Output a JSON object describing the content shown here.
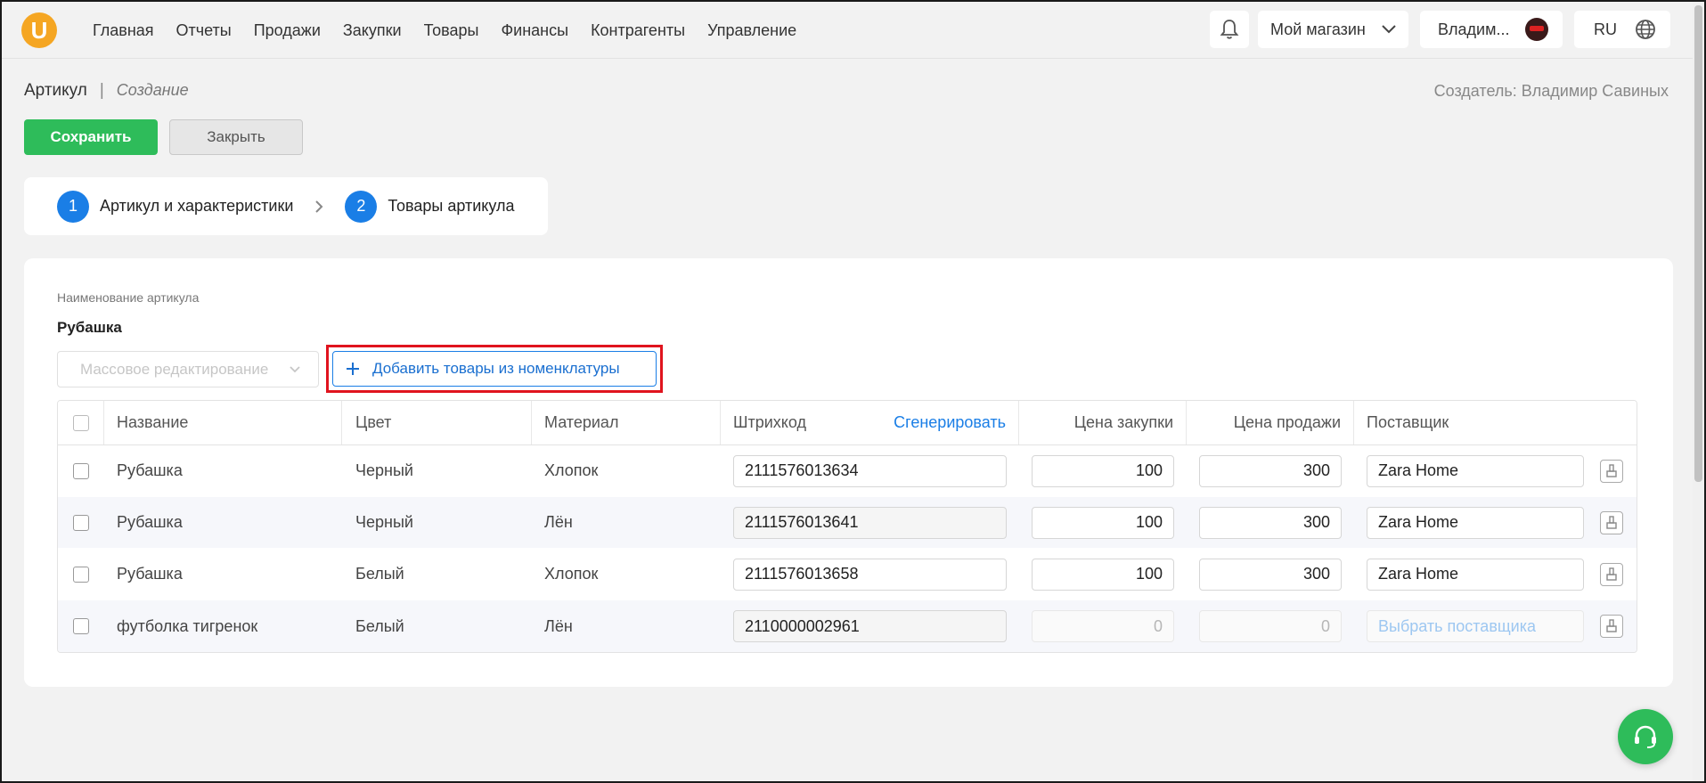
{
  "brand": {
    "logo_letter": "U",
    "logo_color": "#f5a623"
  },
  "nav": {
    "items": [
      "Главная",
      "Отчеты",
      "Продажи",
      "Закупки",
      "Товары",
      "Финансы",
      "Контрагенты",
      "Управление"
    ]
  },
  "header": {
    "store_label": "Мой магазин",
    "user_label": "Владим...",
    "lang_label": "RU"
  },
  "page": {
    "title": "Артикул",
    "separator": "|",
    "subtitle": "Создание",
    "creator": "Создатель: Владимир Савиных"
  },
  "actions": {
    "save_label": "Сохранить",
    "close_label": "Закрыть"
  },
  "steps": [
    {
      "num": "1",
      "label": "Артикул и характеристики"
    },
    {
      "num": "2",
      "label": "Товары артикула"
    }
  ],
  "article": {
    "name_label": "Наименование артикула",
    "name_value": "Рубашка"
  },
  "toolbar": {
    "mass_edit_placeholder": "Массовое редактирование",
    "add_label": "Добавить товары из номенклатуры"
  },
  "table": {
    "columns": {
      "name": "Название",
      "color": "Цвет",
      "material": "Материал",
      "barcode": "Штрихкод",
      "generate": "Сгенерировать",
      "buy_price": "Цена закупки",
      "sell_price": "Цена продажи",
      "supplier": "Поставщик"
    },
    "rows": [
      {
        "name": "Рубашка",
        "color": "Черный",
        "material": "Хлопок",
        "barcode": "2111576013634",
        "buy": "100",
        "sell": "300",
        "supplier": "Zara Home"
      },
      {
        "name": "Рубашка",
        "color": "Черный",
        "material": "Лён",
        "barcode": "2111576013641",
        "buy": "100",
        "sell": "300",
        "supplier": "Zara Home"
      },
      {
        "name": "Рубашка",
        "color": "Белый",
        "material": "Хлопок",
        "barcode": "2111576013658",
        "buy": "100",
        "sell": "300",
        "supplier": "Zara Home"
      },
      {
        "name": "футболка тигренок",
        "color": "Белый",
        "material": "Лён",
        "barcode": "2110000002961",
        "buy": "0",
        "sell": "0",
        "supplier_placeholder": "Выбрать поставщика"
      }
    ]
  },
  "colors": {
    "primary": "#1a7ee6",
    "success": "#2ebc5a",
    "highlight": "#e0141e"
  },
  "icons": [
    "bell-icon",
    "chevron-down-icon",
    "globe-icon",
    "chevron-right-icon",
    "plus-icon",
    "broom-icon",
    "headset-icon"
  ]
}
